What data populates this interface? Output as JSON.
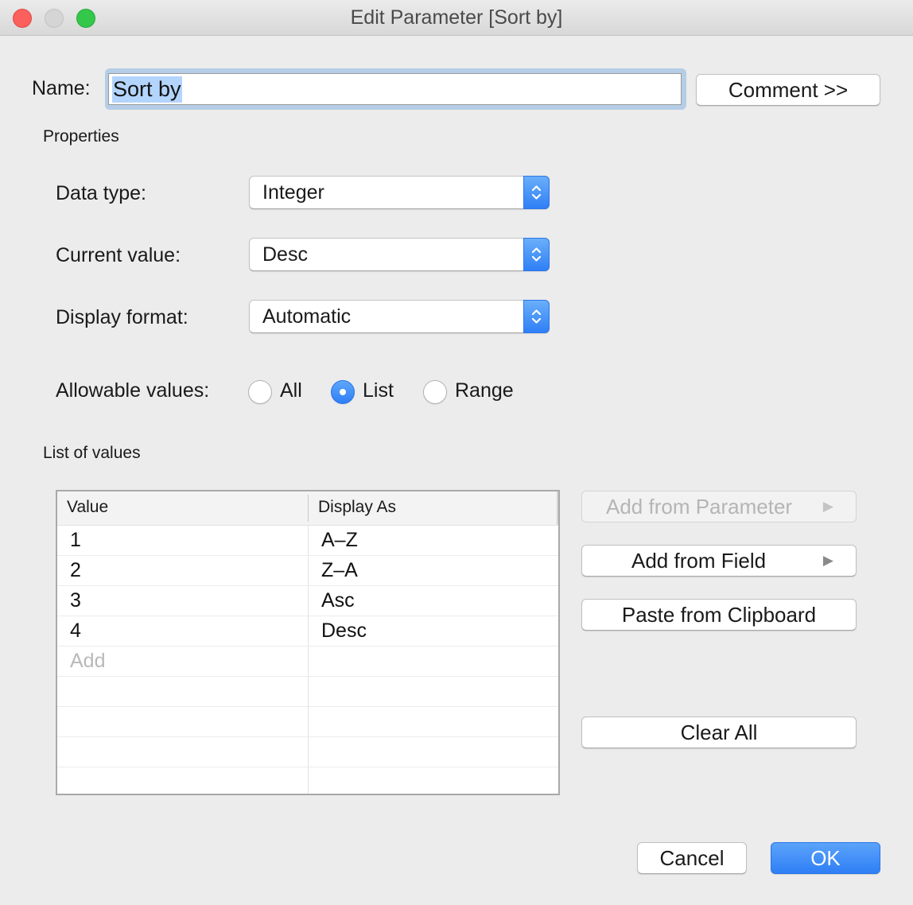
{
  "window": {
    "title": "Edit Parameter [Sort by]"
  },
  "name": {
    "label": "Name:",
    "value": "Sort by",
    "comment_button": "Comment >>"
  },
  "properties": {
    "section_label": "Properties",
    "data_type": {
      "label": "Data type:",
      "value": "Integer"
    },
    "current_value": {
      "label": "Current value:",
      "value": "Desc"
    },
    "display_format": {
      "label": "Display format:",
      "value": "Automatic"
    },
    "allowable_values": {
      "label": "Allowable values:",
      "options": [
        "All",
        "List",
        "Range"
      ],
      "selected": "List"
    }
  },
  "list_of_values": {
    "section_label": "List of values",
    "columns": [
      "Value",
      "Display As"
    ],
    "rows": [
      {
        "value": "1",
        "display": "A–Z"
      },
      {
        "value": "2",
        "display": "Z–A"
      },
      {
        "value": "3",
        "display": "Asc"
      },
      {
        "value": "4",
        "display": "Desc"
      }
    ],
    "add_placeholder": "Add"
  },
  "side_buttons": {
    "add_from_parameter": "Add from Parameter",
    "add_from_field": "Add from Field",
    "paste_from_clipboard": "Paste from Clipboard",
    "clear_all": "Clear All",
    "submenu_arrow": "▶"
  },
  "footer": {
    "cancel": "Cancel",
    "ok": "OK"
  },
  "icons": {
    "close": "close-icon",
    "minimize": "minimize-icon",
    "maximize": "maximize-icon",
    "stepper": "up-down-chevron-icon",
    "submenu": "triangle-right-icon"
  },
  "colors": {
    "accent": "#2f7ff6",
    "window_bg": "#ececec",
    "close": "#fc605c",
    "maximize": "#34c84a",
    "disabled_text": "#b5b5b5",
    "selection": "#b3d4fc"
  }
}
